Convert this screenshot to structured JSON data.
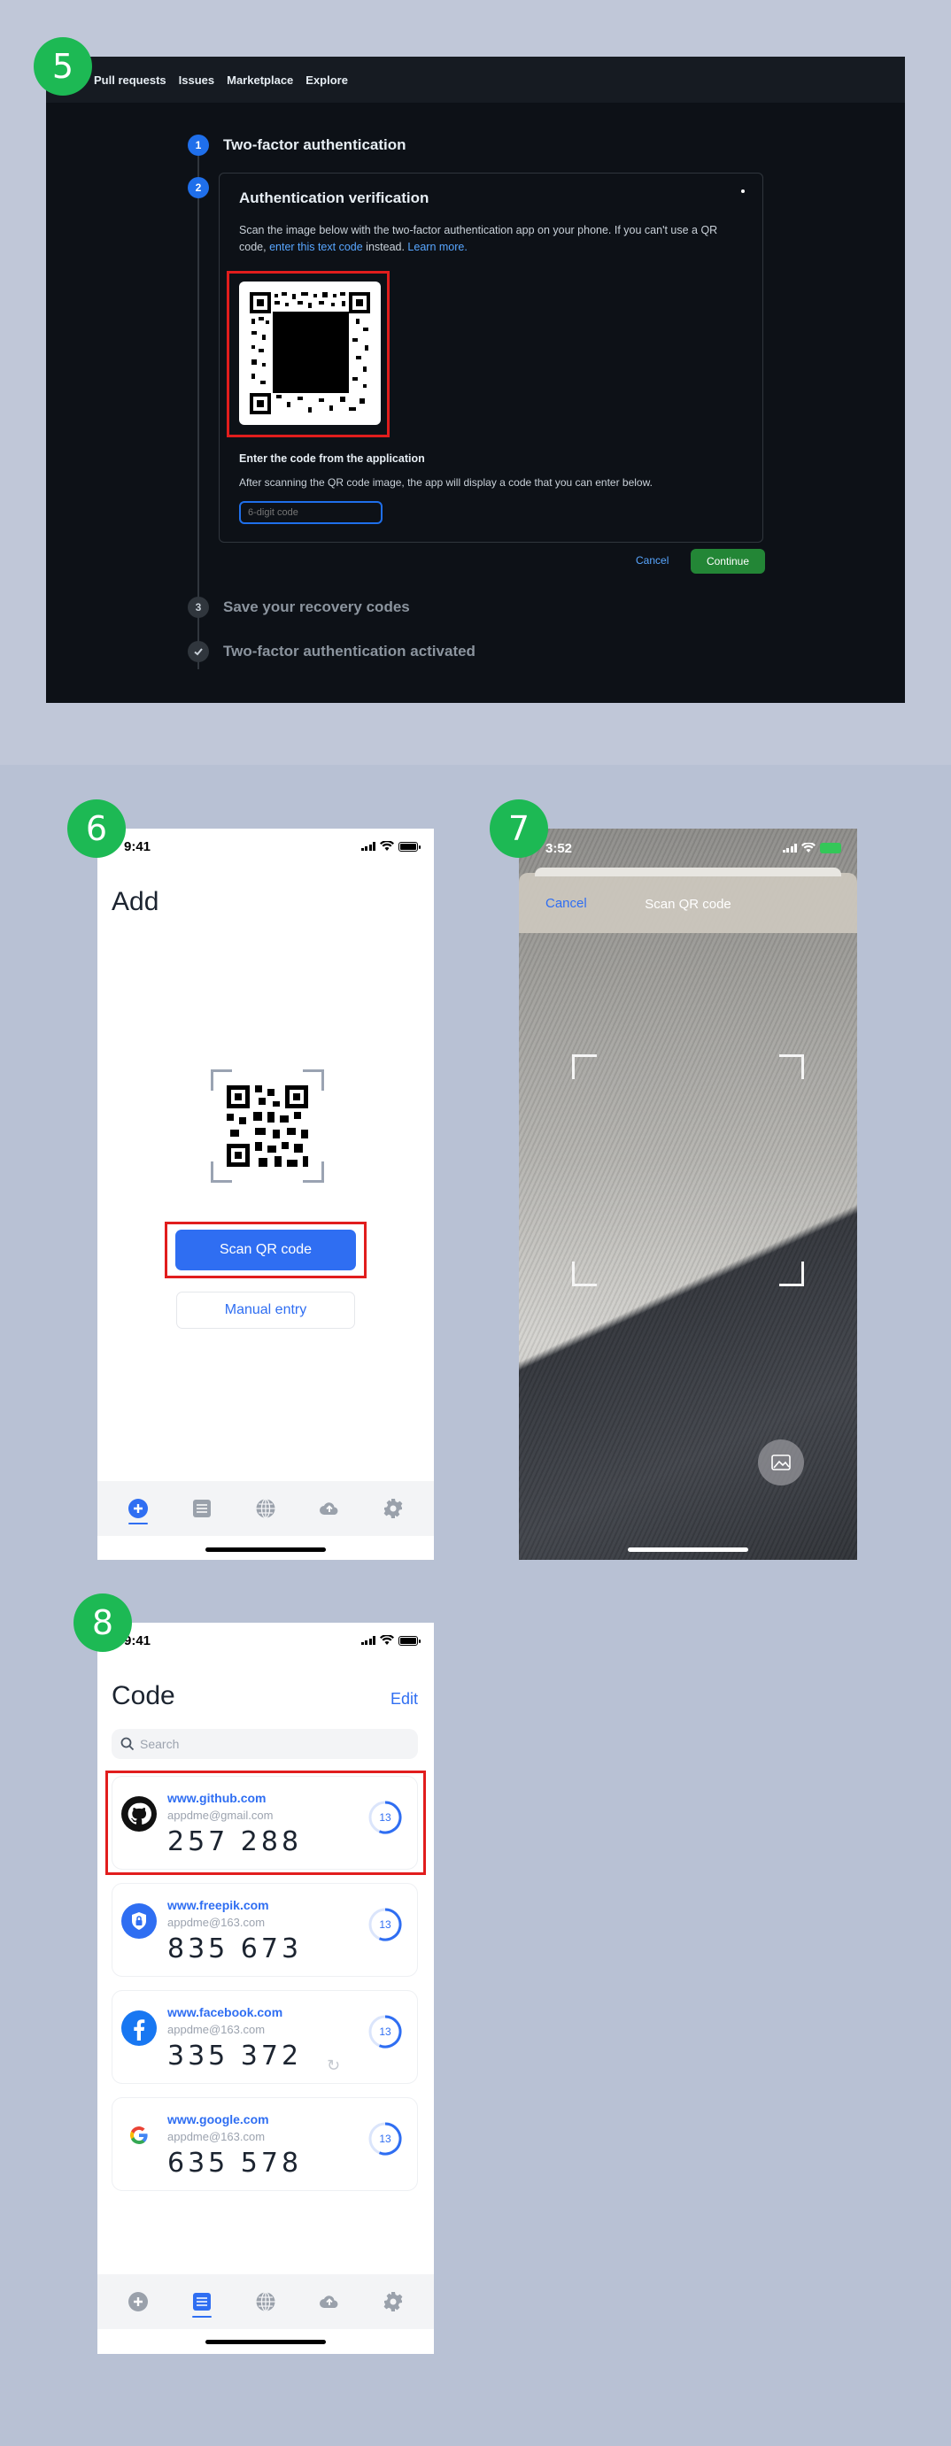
{
  "steps": [
    "5",
    "6",
    "7",
    "8"
  ],
  "github": {
    "nav": [
      "Pull requests",
      "Issues",
      "Marketplace",
      "Explore"
    ],
    "step1": {
      "num": "1",
      "label": "Two-factor authentication"
    },
    "step2": {
      "num": "2"
    },
    "step3": {
      "num": "3",
      "label": "Save your recovery codes"
    },
    "step4": {
      "label": "Two-factor authentication activated"
    },
    "card_title": "Authentication verification",
    "desc_part1": "Scan the image below with the two-factor authentication app on your phone. If you can't use a QR code, ",
    "desc_link1": "enter this text code",
    "desc_part2": " instead. ",
    "desc_link2": "Learn more.",
    "enter_title": "Enter the code from the application",
    "enter_help": "After scanning the QR code image, the app will display a code that you can enter below.",
    "input_placeholder": "6-digit code",
    "cancel": "Cancel",
    "continue": "Continue"
  },
  "add_screen": {
    "time": "9:41",
    "title": "Add",
    "scan_button": "Scan QR code",
    "manual_button": "Manual entry"
  },
  "scan_screen": {
    "time": "3:52",
    "cancel": "Cancel",
    "title": "Scan QR code"
  },
  "code_screen": {
    "time": "9:41",
    "title": "Code",
    "edit": "Edit",
    "search_placeholder": "Search",
    "accounts": [
      {
        "site": "www.github.com",
        "email": "appdme@gmail.com",
        "code": "257 288",
        "timer": "13",
        "icon": "github-icon"
      },
      {
        "site": "www.freepik.com",
        "email": "appdme@163.com",
        "code": "835 673",
        "timer": "13",
        "icon": "freepik-lock-icon"
      },
      {
        "site": "www.facebook.com",
        "email": "appdme@163.com",
        "code": "335 372",
        "timer": "13",
        "icon": "facebook-icon"
      },
      {
        "site": "www.google.com",
        "email": "appdme@163.com",
        "code": "635 578",
        "timer": "13",
        "icon": "google-icon"
      }
    ]
  },
  "tabs": [
    "add-tab",
    "codes-tab",
    "browser-tab",
    "backup-tab",
    "settings-tab"
  ],
  "colors": {
    "accent": "#2f6ef2",
    "highlight": "#e11d1d",
    "badge": "#1db954",
    "github_green": "#238636"
  }
}
